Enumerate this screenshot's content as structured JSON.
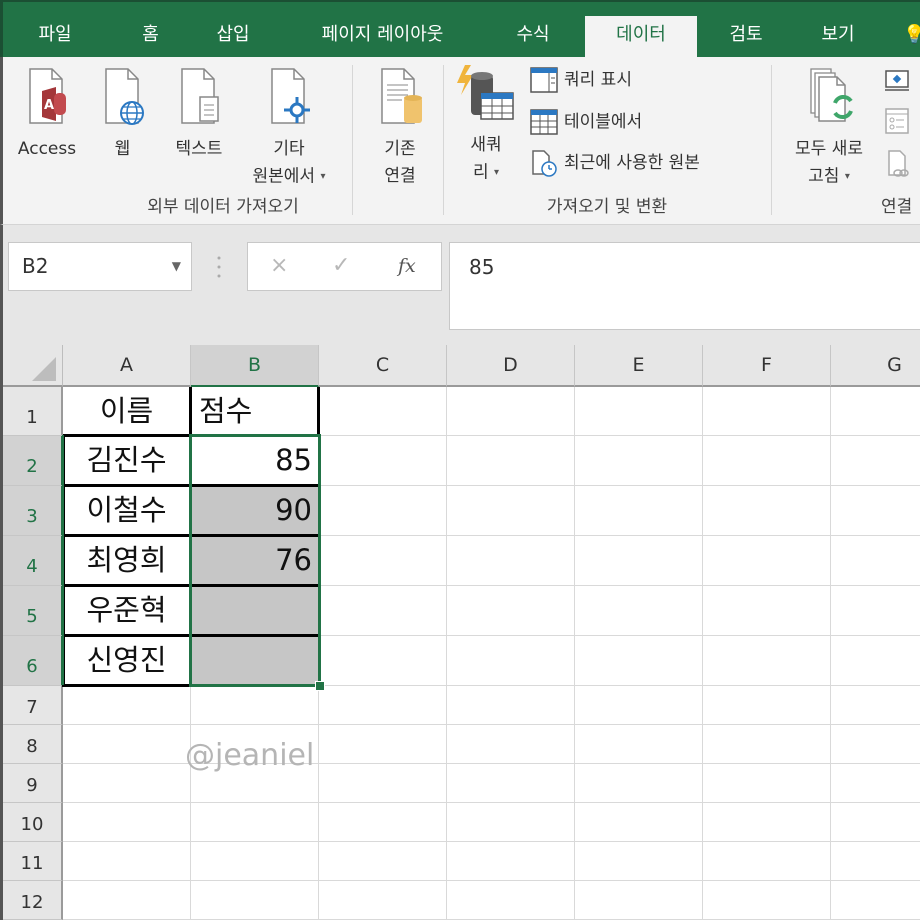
{
  "ribbon_tabs": [
    {
      "label": "파일",
      "active": false
    },
    {
      "label": "홈",
      "active": false
    },
    {
      "label": "삽입",
      "active": false
    },
    {
      "label": "페이지 레이아웃",
      "active": false
    },
    {
      "label": "수식",
      "active": false
    },
    {
      "label": "데이터",
      "active": true
    },
    {
      "label": "검토",
      "active": false
    },
    {
      "label": "보기",
      "active": false
    }
  ],
  "ribbon": {
    "external_data": {
      "group_label": "외부 데이터 가져오기",
      "access": "Access",
      "web": "웹",
      "text": "텍스트",
      "other_line1": "기타",
      "other_line2": "원본에서",
      "existing_line1": "기존",
      "existing_line2": "연결"
    },
    "get_transform": {
      "group_label": "가져오기 및 변환",
      "new_query_line1": "새쿼",
      "new_query_line2": "리",
      "show_queries": "쿼리 표시",
      "from_table": "테이블에서",
      "recent_sources": "최근에 사용한 원본"
    },
    "connections": {
      "group_label": "연결",
      "refresh_line1": "모두 새로",
      "refresh_line2": "고침"
    },
    "dropdown_arrow": "▾"
  },
  "formula_bar": {
    "name_box": "B2",
    "cancel_icon": "×",
    "enter_icon": "✓",
    "fx_label": "fx",
    "value": "85"
  },
  "columns": [
    "A",
    "B",
    "C",
    "D",
    "E",
    "F",
    "G"
  ],
  "selected_column": "B",
  "rows": [
    "1",
    "2",
    "3",
    "4",
    "5",
    "6",
    "7",
    "8",
    "9",
    "10",
    "11",
    "12"
  ],
  "selected_rows": [
    "2",
    "3",
    "4",
    "5",
    "6"
  ],
  "cells": {
    "A1": "이름",
    "B1": "점수",
    "A2": "김진수",
    "B2": "85",
    "A3": "이철수",
    "B3": "90",
    "A4": "최영희",
    "B4": "76",
    "A5": "우준혁",
    "B5": "",
    "A6": "신영진",
    "B6": ""
  },
  "watermark": "@jeaniel",
  "colors": {
    "accent": "#217346",
    "selection_fill": "#c6c6c6"
  }
}
